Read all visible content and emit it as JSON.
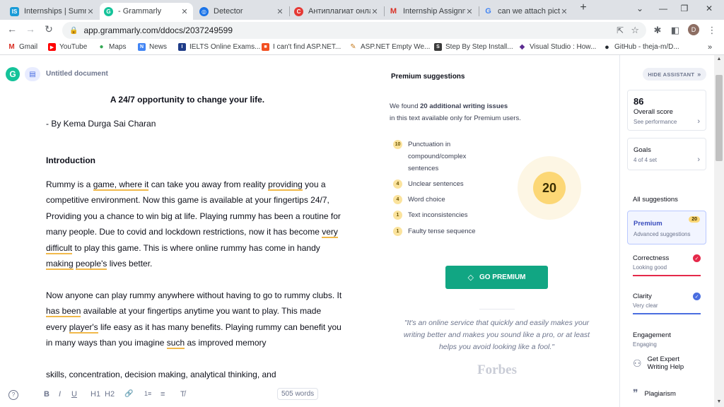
{
  "browser": {
    "tabs": [
      {
        "title": "Internships | Summ",
        "favicon": "IS",
        "color": "#1a9bd7"
      },
      {
        "title": "- Grammarly",
        "favicon": "G",
        "color": "#15c39a",
        "active": true
      },
      {
        "title": "Detector",
        "favicon": "◎",
        "color": "#1a73e8"
      },
      {
        "title": "Антиплагиат онлай",
        "favicon": "C",
        "color": "#e53935"
      },
      {
        "title": "Internship Assignm",
        "favicon": "M",
        "color": "#d93025"
      },
      {
        "title": "can we attach pictu",
        "favicon": "G",
        "color": "#4285f4"
      }
    ],
    "close_glyph": "✕",
    "new_tab": "+",
    "url": "app.grammarly.com/ddocs/2037249599",
    "profile_initial": "D",
    "bookmarks": [
      {
        "label": "Gmail",
        "icon": "M",
        "color": "#d93025"
      },
      {
        "label": "YouTube",
        "icon": "▶",
        "color": "#ff0000"
      },
      {
        "label": "Maps",
        "icon": "●",
        "color": "#34a853"
      },
      {
        "label": "News",
        "icon": "N",
        "color": "#4285f4"
      },
      {
        "label": "IELTS Online Exams...",
        "icon": "I",
        "color": "#1f3c88"
      },
      {
        "label": "I can't find ASP.NET...",
        "icon": "■",
        "color": "#f25022"
      },
      {
        "label": "ASP.NET Empty We...",
        "icon": "✎",
        "color": "#c77d22"
      },
      {
        "label": "Step By Step Install...",
        "icon": "S",
        "color": "#3a3a3a"
      },
      {
        "label": "Visual Studio : How...",
        "icon": "◆",
        "color": "#5c2d91"
      },
      {
        "label": "GitHub - theja-m/D...",
        "icon": "●",
        "color": "#24292f"
      }
    ],
    "more_bookmarks": "»"
  },
  "grammarly": {
    "logo": "G",
    "doc_title": "Untitled document",
    "document": {
      "title": "A 24/7 opportunity to change your life.",
      "byline": "- By Kema Durga Sai Charan",
      "heading": "Introduction",
      "p1": [
        "Rummy is a ",
        "game, where it",
        " can take you away from reality ",
        "providing",
        " you a competitive environment. Now this game is available at your fingertips 24/7, Providing you a chance to win big at life. Playing rummy has been a routine for many people. Due to covid and lockdown restrictions, now it has become ",
        "very difficult",
        " to play this game. This is where online rummy has come in handy ",
        "making",
        " ",
        "people's",
        " lives better."
      ],
      "p2": [
        "Now anyone can play rummy anywhere without having to go to rummy clubs. It ",
        "has been",
        " available at your fingertips anytime you want to play. This made every ",
        "player's",
        " life easy as it has many benefits. Playing rummy can benefit you in many ways than you imagine ",
        "such",
        " as improved memory"
      ],
      "p3": "skills, concentration, decision making, analytical thinking, and"
    },
    "toolbar": {
      "help": "?",
      "bold": "B",
      "italic": "I",
      "underline": "U",
      "h1": "H1",
      "h2": "H2",
      "link": "🔗",
      "ol": "1≡",
      "ul": "≡",
      "clear": "T̸",
      "words": "505 words"
    },
    "premium": {
      "title": "Premium suggestions",
      "found_pre": "We found ",
      "found_bold": "20 additional writing issues",
      "found_post": "in this text available only for Premium users.",
      "issues": [
        {
          "count": "10",
          "label": "Punctuation in compound/complex sentences"
        },
        {
          "count": "4",
          "label": "Unclear sentences"
        },
        {
          "count": "4",
          "label": "Word choice"
        },
        {
          "count": "1",
          "label": "Text inconsistencies"
        },
        {
          "count": "1",
          "label": "Faulty tense sequence"
        }
      ],
      "total": "20",
      "cta": "GO PREMIUM",
      "quote": "\"It's an online service that quickly and easily makes your writing better and makes you sound like a pro, or at least helps you avoid looking like a fool.\"",
      "quote_source": "Forbes"
    },
    "assistant": {
      "hide": "HIDE ASSISTANT",
      "score": "86",
      "score_label": "Overall score",
      "score_link": "See performance",
      "goals_label": "Goals",
      "goals_sub": "4 of 4 set",
      "all_suggestions": "All suggestions",
      "premium_label": "Premium",
      "premium_sub": "Advanced suggestions",
      "premium_count": "20",
      "correctness": "Correctness",
      "correctness_sub": "Looking good",
      "correctness_color": "#e5294a",
      "clarity": "Clarity",
      "clarity_sub": "Very clear",
      "clarity_color": "#4a6ee0",
      "engagement": "Engagement",
      "engagement_sub": "Engaging",
      "expert": "Get Expert Writing Help",
      "plagiarism": "Plagiarism"
    }
  }
}
